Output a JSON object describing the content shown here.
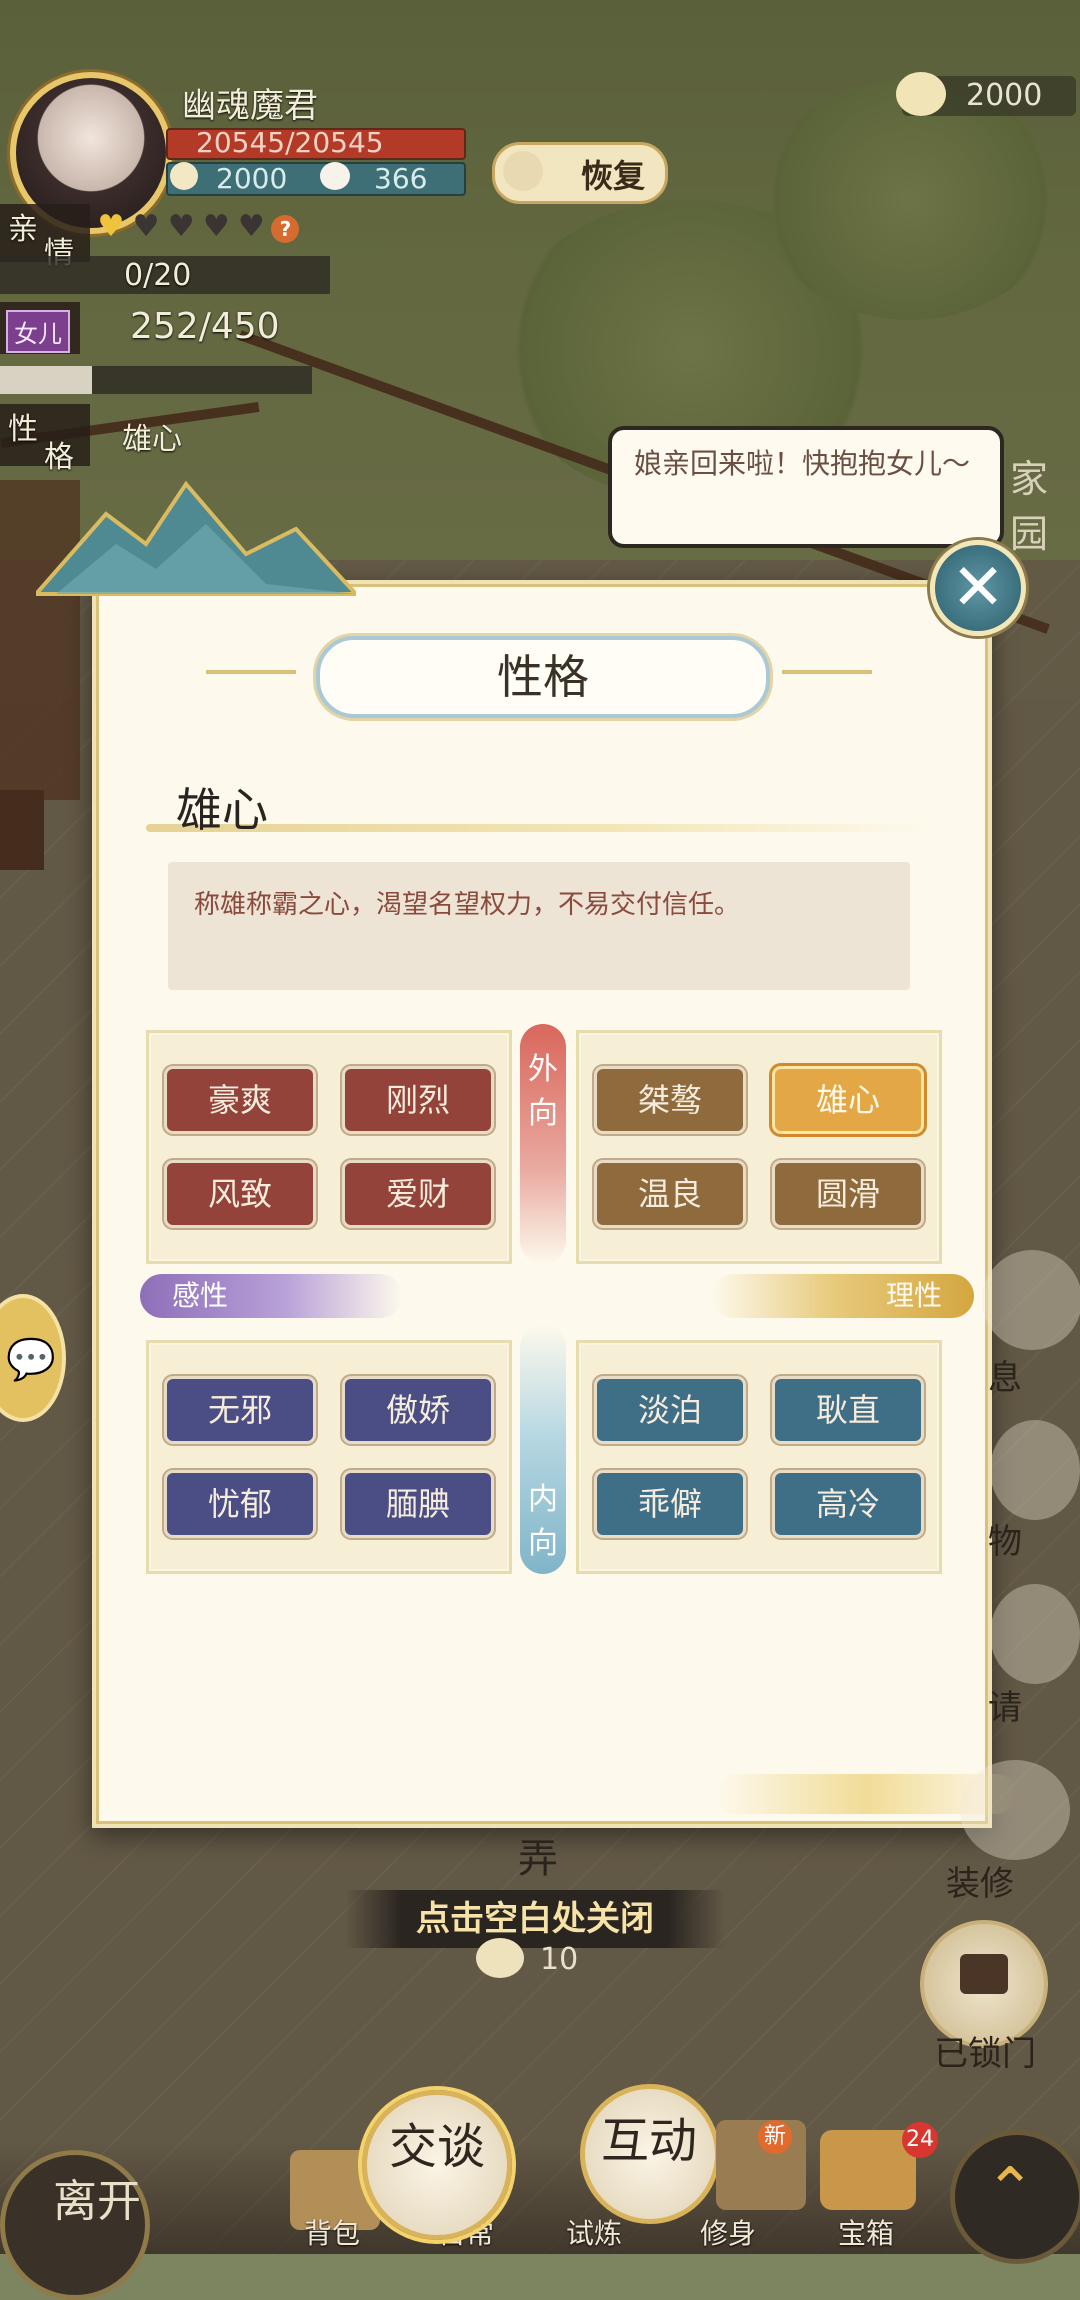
{
  "player": {
    "name": "幽魂魔君",
    "hp": "20545/20545",
    "currency1": "2000",
    "currency2": "366",
    "restore_label": "恢复",
    "top_currency": "2000"
  },
  "status": {
    "intimacy_label_1": "亲",
    "intimacy_label_2": "情",
    "intimacy_progress": "0/20",
    "daughter_label": "女儿",
    "daughter_value": "252/450",
    "trait_label_1": "性",
    "trait_label_2": "格",
    "trait_value": "雄心"
  },
  "bubble": {
    "text": "娘亲回来啦！快抱抱女儿～"
  },
  "modal": {
    "title": "性格",
    "current_trait": "雄心",
    "description": "称雄称霸之心，渴望名望权力，不易交付信任。",
    "axis_top_1": "外",
    "axis_top_2": "向",
    "axis_bottom_1": "内",
    "axis_bottom_2": "向",
    "sensibility": "感性",
    "rationality": "理性",
    "quadrants": {
      "top_left": [
        "豪爽",
        "刚烈",
        "风致",
        "爱财"
      ],
      "top_right": [
        "桀骜",
        "雄心",
        "温良",
        "圆滑"
      ],
      "bottom_left": [
        "无邪",
        "傲娇",
        "忧郁",
        "腼腆"
      ],
      "bottom_right": [
        "淡泊",
        "耿直",
        "乖僻",
        "高冷"
      ]
    },
    "selected": "雄心"
  },
  "close_hint": "点击空白处关闭",
  "bg_labels": {
    "home": "家园",
    "pot_label": "弄",
    "pot_value": "10"
  },
  "side": {
    "rest": "息",
    "item": "物",
    "invite": "请",
    "decorate": "装修",
    "locked": "已锁门"
  },
  "nav": {
    "leave": "离开",
    "talk": "交谈",
    "interact": "互动",
    "bag": "背包",
    "daily": "日常",
    "trial": "试炼",
    "cultivate": "修身",
    "chest": "宝箱",
    "new_badge": "新",
    "chest_badge": "24"
  },
  "colors": {
    "outward": "#d9675c",
    "inward": "#7fb5c8",
    "sensibility": "#8d6fb8",
    "rationality": "#d4a63f",
    "selected": "#e3a746"
  }
}
